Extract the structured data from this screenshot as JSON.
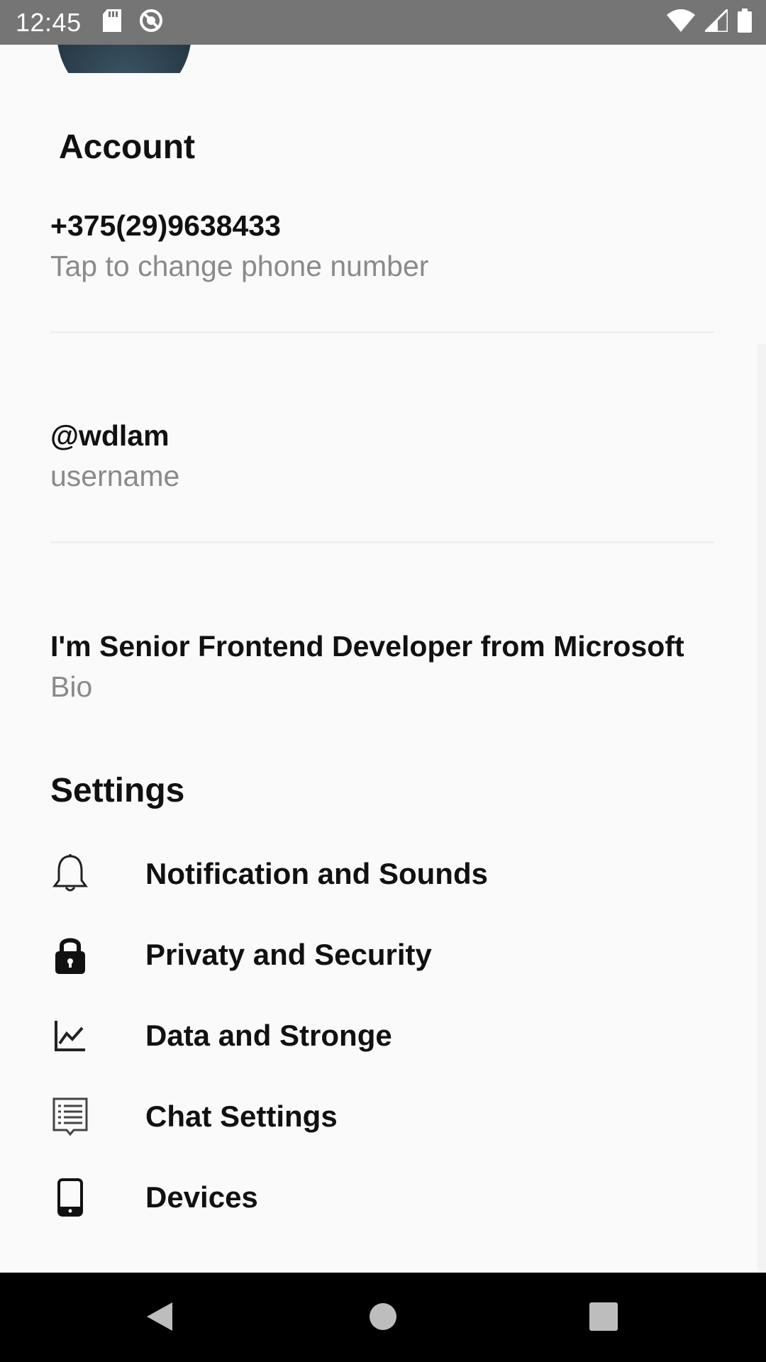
{
  "status_bar": {
    "time": "12:45",
    "left_icons": [
      "sd-card-icon",
      "sync-blocked-icon"
    ],
    "right_icons": [
      "wifi-icon",
      "signal-icon",
      "battery-icon"
    ]
  },
  "account": {
    "title": "Account",
    "phone_value": "+375(29)9638433",
    "phone_label": "Tap to change phone number",
    "username_value": "@wdlam",
    "username_label": "username",
    "bio_value": "I'm Senior Frontend Developer from Microsoft",
    "bio_label": "Bio"
  },
  "settings": {
    "title": "Settings",
    "items": [
      {
        "label": "Notification and Sounds",
        "icon": "bell-icon"
      },
      {
        "label": "Privaty and Security",
        "icon": "lock-icon"
      },
      {
        "label": "Data and Stronge",
        "icon": "chart-icon"
      },
      {
        "label": "Chat Settings",
        "icon": "chat-list-icon"
      },
      {
        "label": "Devices",
        "icon": "phone-icon"
      }
    ]
  },
  "nav_bar": {
    "buttons": [
      "back-icon",
      "home-icon",
      "recents-icon"
    ]
  }
}
